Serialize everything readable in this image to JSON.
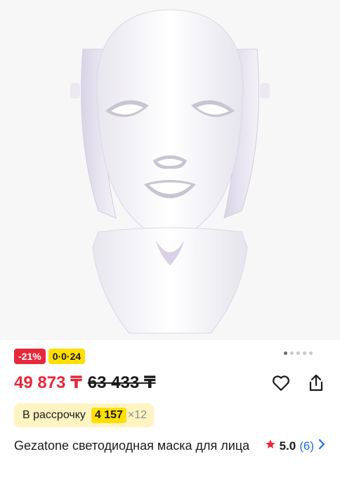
{
  "badges": {
    "discount": "-21%",
    "installment": "0·0·24"
  },
  "gallery": {
    "image_icon": "face-mask-product-image",
    "pages": 5,
    "active_page": 1
  },
  "price": {
    "current": "49 873 ₸",
    "old": "63 433 ₸"
  },
  "installment": {
    "label": "В рассрочку",
    "amount": "4 157",
    "multiplier": "×12"
  },
  "product": {
    "title": "Gezatone светодиодная маска для лица"
  },
  "rating": {
    "value": "5.0",
    "count": "(6)"
  },
  "colors": {
    "accent_red": "#e8283a",
    "accent_yellow": "#ffde00",
    "link_blue": "#1f6fe5"
  }
}
